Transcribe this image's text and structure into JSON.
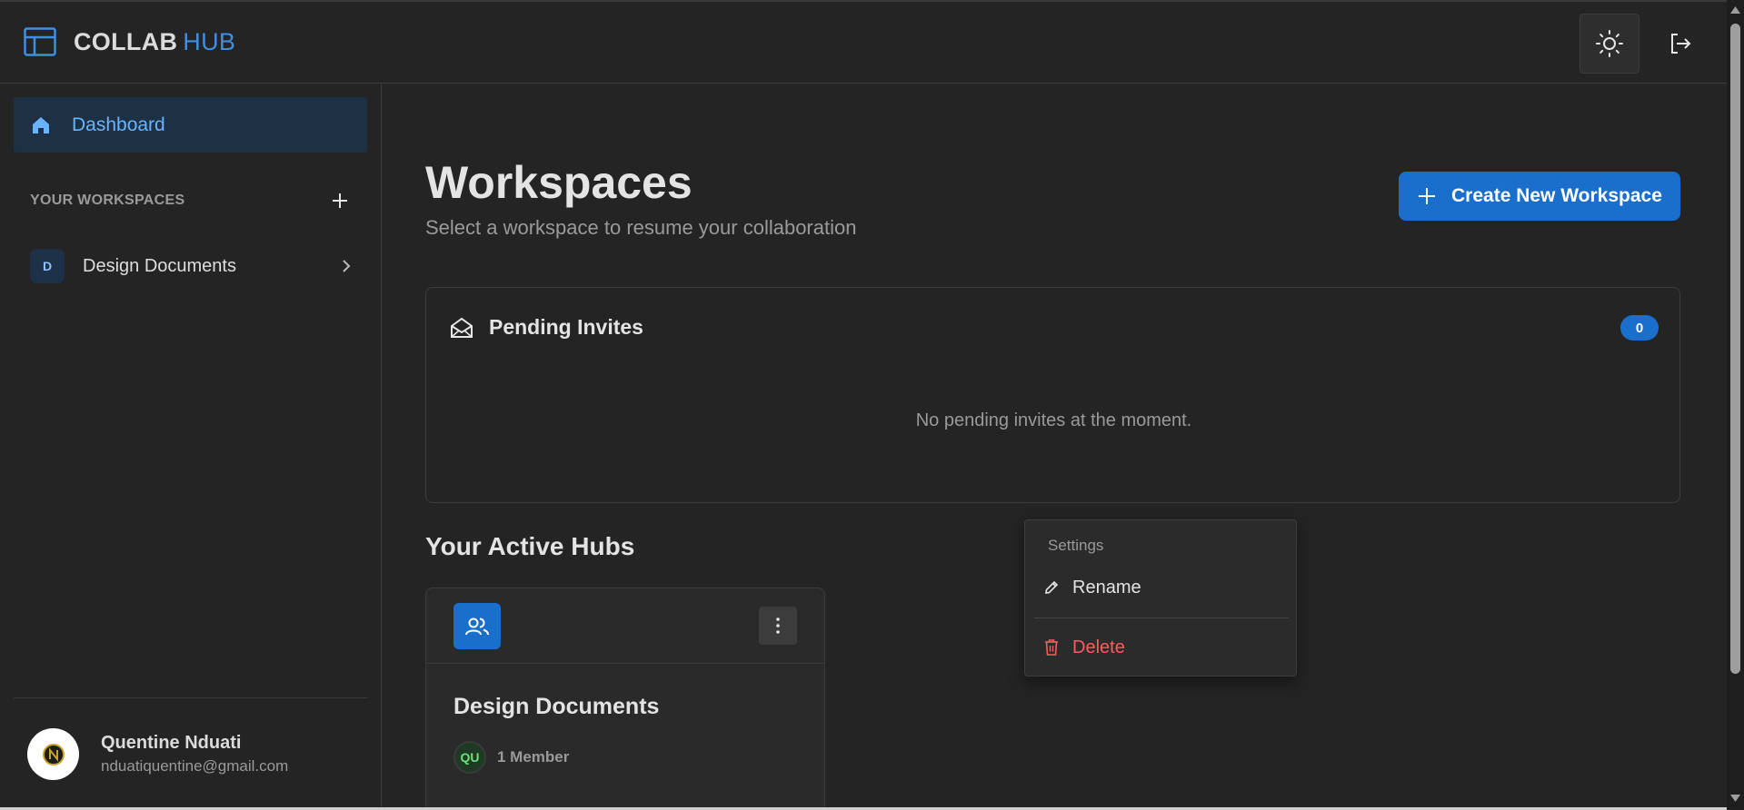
{
  "app": {
    "logo_primary": "COLLAB",
    "logo_secondary": "HUB"
  },
  "topbar": {
    "theme_icon": "sun-icon",
    "logout_icon": "logout-icon"
  },
  "sidebar": {
    "dashboard_label": "Dashboard",
    "workspaces_header": "YOUR WORKSPACES",
    "workspaces": [
      {
        "initial": "D",
        "name": "Design Documents"
      }
    ],
    "user": {
      "name": "Quentine Nduati",
      "email": "nduatiquentine@gmail.com"
    }
  },
  "main": {
    "title": "Workspaces",
    "subtitle": "Select a workspace to resume your collaboration",
    "create_button": "Create New Workspace",
    "invites": {
      "title": "Pending Invites",
      "count": "0",
      "empty_message": "No pending invites at the moment."
    },
    "hubs_title": "Your Active Hubs",
    "hubs": [
      {
        "name": "Design Documents",
        "member_initials": "QU",
        "members_label": "1 Member"
      }
    ]
  },
  "context_menu": {
    "header": "Settings",
    "rename": "Rename",
    "delete": "Delete"
  },
  "colors": {
    "background": "#242424",
    "accent": "#1a6fcc",
    "accent_text": "#3d8fe6",
    "danger": "#ff5a5f"
  }
}
